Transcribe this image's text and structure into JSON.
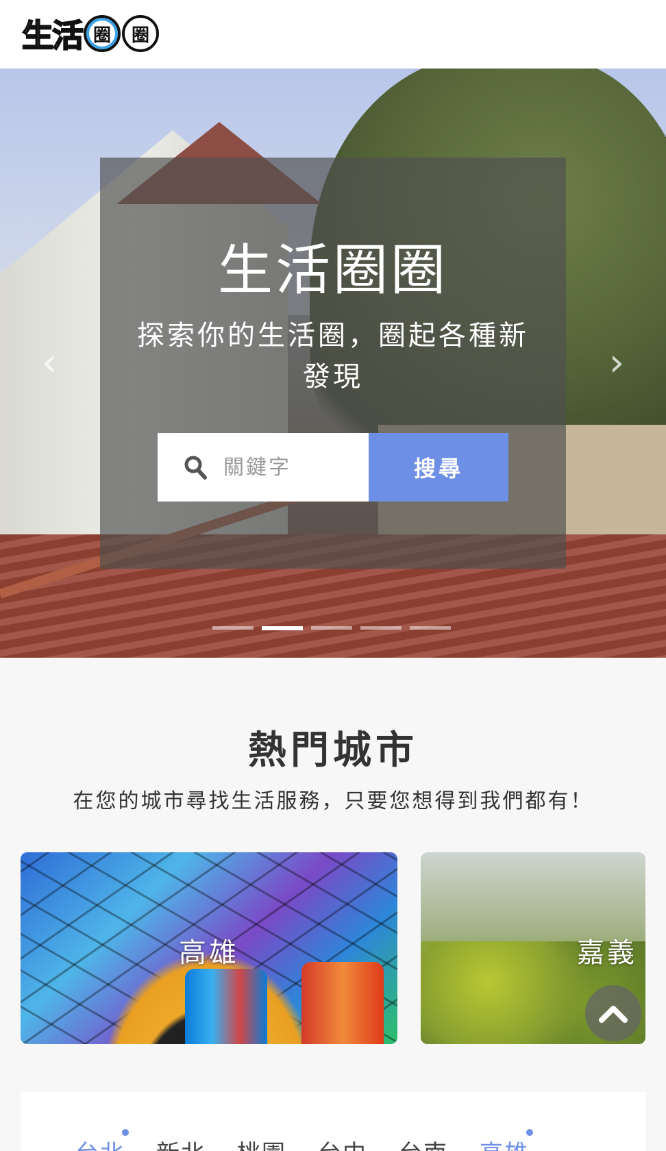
{
  "header": {
    "logo_text": "生活",
    "logo_ring1": "圈",
    "logo_ring2": "圈"
  },
  "hero": {
    "title": "生活圈圈",
    "subtitle": "探索你的生活圈，圈起各種新發現",
    "search": {
      "placeholder": "關鍵字",
      "button_label": "搜尋"
    },
    "prev_arrow": "‹",
    "next_arrow": "›",
    "slide_count": 5,
    "active_slide": 1
  },
  "hot_cities": {
    "title": "熱門城市",
    "subtitle": "在您的城市尋找生活服務，只要您想得到我們都有！",
    "cards": [
      {
        "name": "高雄"
      },
      {
        "name": "嘉義"
      }
    ]
  },
  "city_tabs": {
    "items": [
      {
        "label": "台北",
        "active": true,
        "dot": true
      },
      {
        "label": "新北",
        "active": false,
        "dot": false
      },
      {
        "label": "桃園",
        "active": false,
        "dot": false
      },
      {
        "label": "台中",
        "active": false,
        "dot": false
      },
      {
        "label": "台南",
        "active": false,
        "dot": false
      },
      {
        "label": "高雄",
        "active": true,
        "dot": true
      }
    ]
  },
  "colors": {
    "accent": "#6d8fe6",
    "overlay": "#505050",
    "background": "#f7f7f7"
  },
  "icons": {
    "search": "search-icon",
    "scroll_top": "chevron-up-icon",
    "prev": "chevron-left-icon",
    "next": "chevron-right-icon"
  }
}
